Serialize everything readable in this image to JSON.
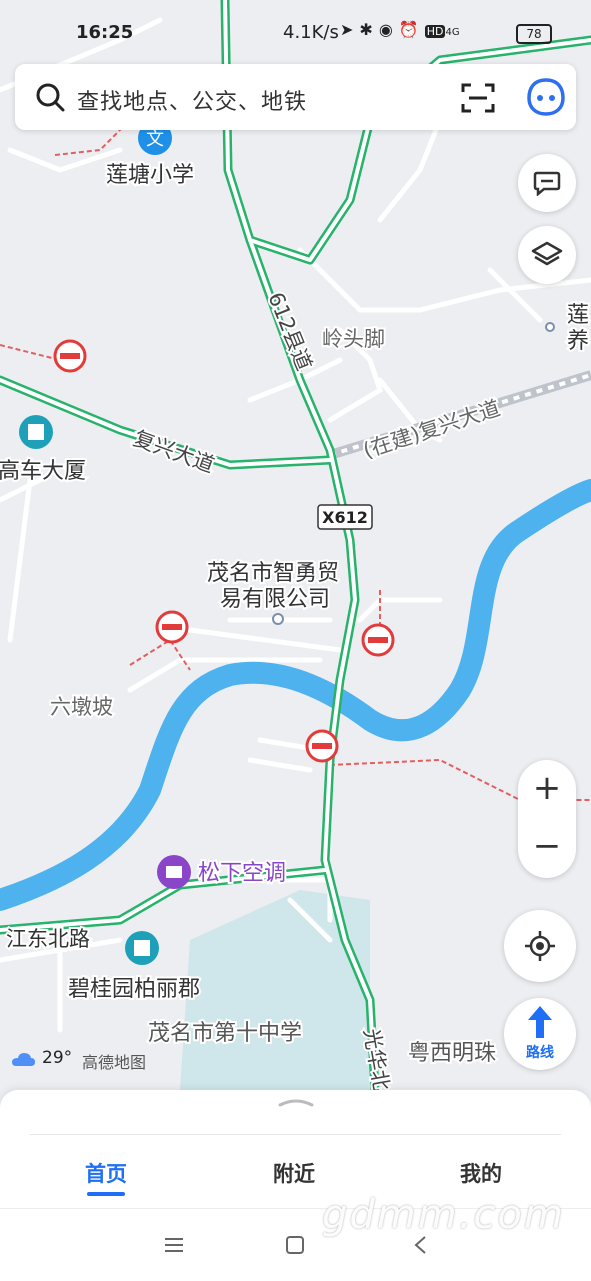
{
  "status_bar": {
    "time": "16:25",
    "net_speed": "4.1K/s",
    "battery": "78",
    "icons": [
      "location-icon",
      "bluetooth-icon",
      "toggle-icon",
      "alarm-icon",
      "hd-icon",
      "4g-signal-icon",
      "battery-icon"
    ],
    "network": "4G",
    "hd": "HD"
  },
  "search": {
    "placeholder": "查找地点、公交、地铁"
  },
  "map": {
    "labels": {
      "liantang_school": "莲塘小学",
      "lingtoujiao": "岭头脚",
      "road_612": "612县道",
      "fuxing_avenue_left": "复兴大道",
      "fuxing_avenue_right": "(在建)复兴大道",
      "gaoche_building": "高车大厦",
      "x612": "X612",
      "company_line1": "茂名市智勇贸",
      "company_line2": "易有限公司",
      "liudunpo": "六墩坡",
      "panasonic": "松下空调",
      "jiangdong_north_road": "江东北路",
      "biguiyuan": "碧桂园柏丽郡",
      "school_10": "茂名市第十中学",
      "guanghua": "光华北",
      "yuexi": "粤西明珠",
      "lian_edge_1": "莲",
      "lian_edge_2": "养"
    },
    "colors": {
      "background": "#eceef2",
      "river": "#4db2ee",
      "road_green": "#27b36b",
      "road_white": "#ffffff",
      "school_area": "#cfe6ea",
      "poi_teal": "#1ea1b8",
      "poi_purple": "#8a46c9",
      "restriction_red": "#e23b3b"
    }
  },
  "controls": {
    "feedback_icon": "message-icon",
    "layers_icon": "layers-icon",
    "zoom_in": "+",
    "zoom_out": "−",
    "locate_icon": "locate-icon",
    "route_label": "路线"
  },
  "weather": {
    "temperature": "29°",
    "brand": "高德地图"
  },
  "tabs": [
    {
      "label": "首页",
      "active": true
    },
    {
      "label": "附近",
      "active": false
    },
    {
      "label": "我的",
      "active": false
    }
  ],
  "watermark": "gdmm.com"
}
